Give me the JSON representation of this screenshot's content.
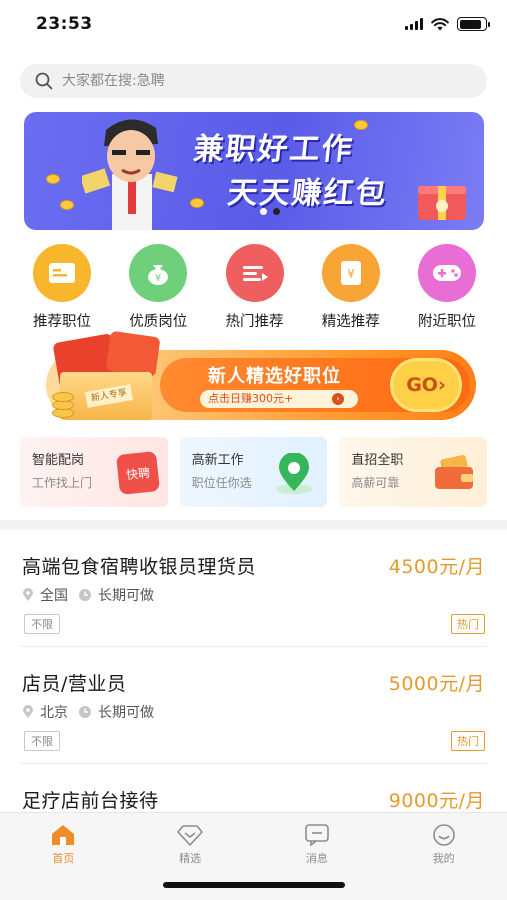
{
  "status_bar": {
    "time": "23:53"
  },
  "search": {
    "placeholder": "大家都在搜:急聘"
  },
  "banner": {
    "line1": "兼职好工作",
    "line2": "天天赚红包",
    "page_count": 2,
    "active_page": 2
  },
  "categories": [
    {
      "label": "推荐职位",
      "icon": "card-icon",
      "color": "#f8b62d"
    },
    {
      "label": "优质岗位",
      "icon": "money-bag-icon",
      "color": "#6fcf7a"
    },
    {
      "label": "热门推荐",
      "icon": "hot-list-icon",
      "color": "#ef5f5f"
    },
    {
      "label": "精选推荐",
      "icon": "yen-card-icon",
      "color": "#f7a535"
    },
    {
      "label": "附近职位",
      "icon": "gamepad-icon",
      "color": "#e86dd5"
    }
  ],
  "promo": {
    "badge": "新人专享",
    "title": "新人精选好职位",
    "subtitle": "点击日赚300元+",
    "go": "GO"
  },
  "features": [
    {
      "title": "智能配岗",
      "subtitle": "工作找上门",
      "icon": "kuaipin-icon",
      "icon_text": "快聘"
    },
    {
      "title": "高新工作",
      "subtitle": "职位任你选",
      "icon": "location-pin-icon"
    },
    {
      "title": "直招全职",
      "subtitle": "高薪可靠",
      "icon": "wallet-icon"
    }
  ],
  "jobs": [
    {
      "title": "高端包食宿聘收银员理货员",
      "salary": "4500元/月",
      "location": "全国",
      "duration": "长期可做",
      "tag": "不限",
      "badge": "热门"
    },
    {
      "title": "店员/营业员",
      "salary": "5000元/月",
      "location": "北京",
      "duration": "长期可做",
      "tag": "不限",
      "badge": "热门"
    },
    {
      "title": "足疗店前台接待",
      "salary": "9000元/月",
      "location": "",
      "duration": "",
      "tag": "",
      "badge": ""
    }
  ],
  "tabbar": {
    "active": 0,
    "items": [
      {
        "label": "首页",
        "icon": "home-icon"
      },
      {
        "label": "精选",
        "icon": "diamond-icon"
      },
      {
        "label": "消息",
        "icon": "message-icon"
      },
      {
        "label": "我的",
        "icon": "smile-icon"
      }
    ]
  },
  "colors": {
    "accent": "#f08c2a",
    "salary": "#e59a2c",
    "banner": "#6b6df2"
  }
}
